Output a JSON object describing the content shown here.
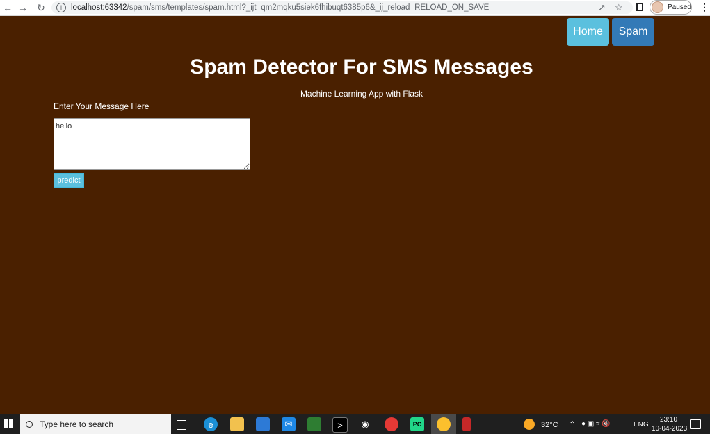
{
  "browser": {
    "url_host": "localhost:63342",
    "url_rest": "/spam/sms/templates/spam.html?_ijt=qm2mqku5siek6fhibuqt6385p6&_ij_reload=RELOAD_ON_SAVE",
    "profile_status": "Paused"
  },
  "nav": {
    "home_label": "Home",
    "spam_label": "Spam"
  },
  "header": {
    "title": "Spam Detector For SMS Messages",
    "subtitle": "Machine Learning App with Flask"
  },
  "form": {
    "label": "Enter Your Message Here",
    "message_value": "hello",
    "predict_label": "predict"
  },
  "taskbar": {
    "search_placeholder": "Type here to search",
    "temperature": "32°C",
    "language": "ENG",
    "time": "23:10",
    "date": "10-04-2023"
  },
  "colors": {
    "page_bg": "#4a2000",
    "home_btn": "#5bc0de",
    "spam_btn": "#337ab7",
    "predict_btn": "#5bc0de"
  }
}
